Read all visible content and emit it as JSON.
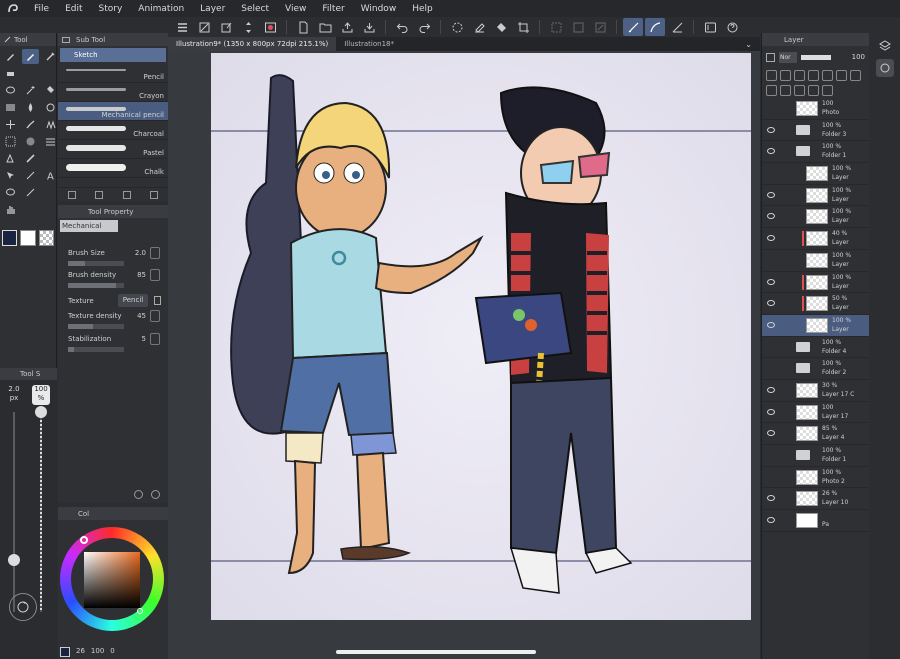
{
  "menu": [
    "File",
    "Edit",
    "Story",
    "Animation",
    "Layer",
    "Select",
    "View",
    "Filter",
    "Window",
    "Help"
  ],
  "tool_panel": {
    "title": "Tool"
  },
  "subtool_panel": {
    "title": "Sub Tool",
    "group": "Sketch",
    "brushes": [
      {
        "label": "Pencil",
        "color": "#9a9ca0",
        "active": false
      },
      {
        "label": "Crayon",
        "color": "#9a9ca0",
        "active": false
      },
      {
        "label": "Mechanical pencil",
        "color": "#c8cacd",
        "active": true
      },
      {
        "label": "Charcoal",
        "color": "#e6e6e6",
        "active": false
      },
      {
        "label": "Pastel",
        "color": "#e6e6e6",
        "active": false
      },
      {
        "label": "Chalk",
        "color": "#f0f0f0",
        "active": false
      }
    ]
  },
  "tool_property": {
    "title": "Tool Property",
    "tool_name": "Mechanical pencil",
    "brush_size_label": "Brush Size",
    "brush_size": "2.0",
    "brush_density_label": "Brush density",
    "brush_density": "85",
    "texture_label": "Texture",
    "texture_value": "Pencil",
    "texture_density_label": "Texture density",
    "texture_density": "45",
    "stabilization_label": "Stabilization",
    "stabilization": "5"
  },
  "size_panel": {
    "title": "Tool S",
    "size": "2.0",
    "unit": "px",
    "opacity": "100",
    "opacity_unit": "%"
  },
  "color_panel": {
    "title": "Col",
    "r": "26",
    "g": "100",
    "b": "0",
    "main_color": "#1a2340",
    "sub_color": "#ffffff"
  },
  "tabs": [
    {
      "label": "Illustration9* (1350 x 800px 72dpi 215.1%)",
      "active": true
    },
    {
      "label": "Illustration18*",
      "active": false
    }
  ],
  "layer_panel": {
    "title": "Layer",
    "blend": "Nor",
    "opacity": "100",
    "layers": [
      {
        "pct": "100",
        "name": "Photo",
        "kind": "thumb",
        "eye": false,
        "red": false,
        "sel": false,
        "indent": 0
      },
      {
        "pct": "100 %",
        "name": "Folder 3",
        "kind": "folder",
        "eye": true,
        "red": false,
        "sel": false,
        "indent": 0
      },
      {
        "pct": "100 %",
        "name": "Folder 1",
        "kind": "folder",
        "eye": true,
        "red": false,
        "sel": false,
        "indent": 0
      },
      {
        "pct": "100 %",
        "name": "Layer",
        "kind": "thumb",
        "eye": false,
        "red": false,
        "sel": false,
        "indent": 1
      },
      {
        "pct": "100 %",
        "name": "Layer",
        "kind": "thumb",
        "eye": true,
        "red": false,
        "sel": false,
        "indent": 1
      },
      {
        "pct": "100 %",
        "name": "Layer",
        "kind": "thumb",
        "eye": true,
        "red": false,
        "sel": false,
        "indent": 1
      },
      {
        "pct": "40 %",
        "name": "Layer",
        "kind": "thumb",
        "eye": true,
        "red": true,
        "sel": false,
        "indent": 1
      },
      {
        "pct": "100 %",
        "name": "Layer",
        "kind": "thumb",
        "eye": false,
        "red": false,
        "sel": false,
        "indent": 1
      },
      {
        "pct": "100 %",
        "name": "Layer",
        "kind": "thumb",
        "eye": true,
        "red": true,
        "sel": false,
        "indent": 1
      },
      {
        "pct": "50 %",
        "name": "Layer",
        "kind": "thumb",
        "eye": true,
        "red": true,
        "sel": false,
        "indent": 1
      },
      {
        "pct": "100 %",
        "name": "Layer",
        "kind": "thumb",
        "eye": true,
        "red": false,
        "sel": true,
        "indent": 1
      },
      {
        "pct": "100 %",
        "name": "Folder 4",
        "kind": "folder",
        "eye": false,
        "red": false,
        "sel": false,
        "indent": 0
      },
      {
        "pct": "100 %",
        "name": "Folder 2",
        "kind": "folder",
        "eye": false,
        "red": false,
        "sel": false,
        "indent": 0
      },
      {
        "pct": "30 %",
        "name": "Layer 17 C",
        "kind": "thumb",
        "eye": true,
        "red": false,
        "sel": false,
        "indent": 0
      },
      {
        "pct": "100",
        "name": "Layer 17",
        "kind": "thumb",
        "eye": true,
        "red": false,
        "sel": false,
        "indent": 0
      },
      {
        "pct": "85 %",
        "name": "Layer 4",
        "kind": "thumb",
        "eye": true,
        "red": false,
        "sel": false,
        "indent": 0
      },
      {
        "pct": "100 %",
        "name": "Folder 1",
        "kind": "folder",
        "eye": false,
        "red": false,
        "sel": false,
        "indent": 0
      },
      {
        "pct": "100 %",
        "name": "Photo 2",
        "kind": "thumb",
        "eye": false,
        "red": false,
        "sel": false,
        "indent": 0
      },
      {
        "pct": "26 %",
        "name": "Layer 10",
        "kind": "thumb",
        "eye": true,
        "red": false,
        "sel": false,
        "indent": 0
      },
      {
        "pct": "",
        "name": "Pa",
        "kind": "paper",
        "eye": true,
        "red": false,
        "sel": false,
        "indent": 0
      }
    ]
  }
}
